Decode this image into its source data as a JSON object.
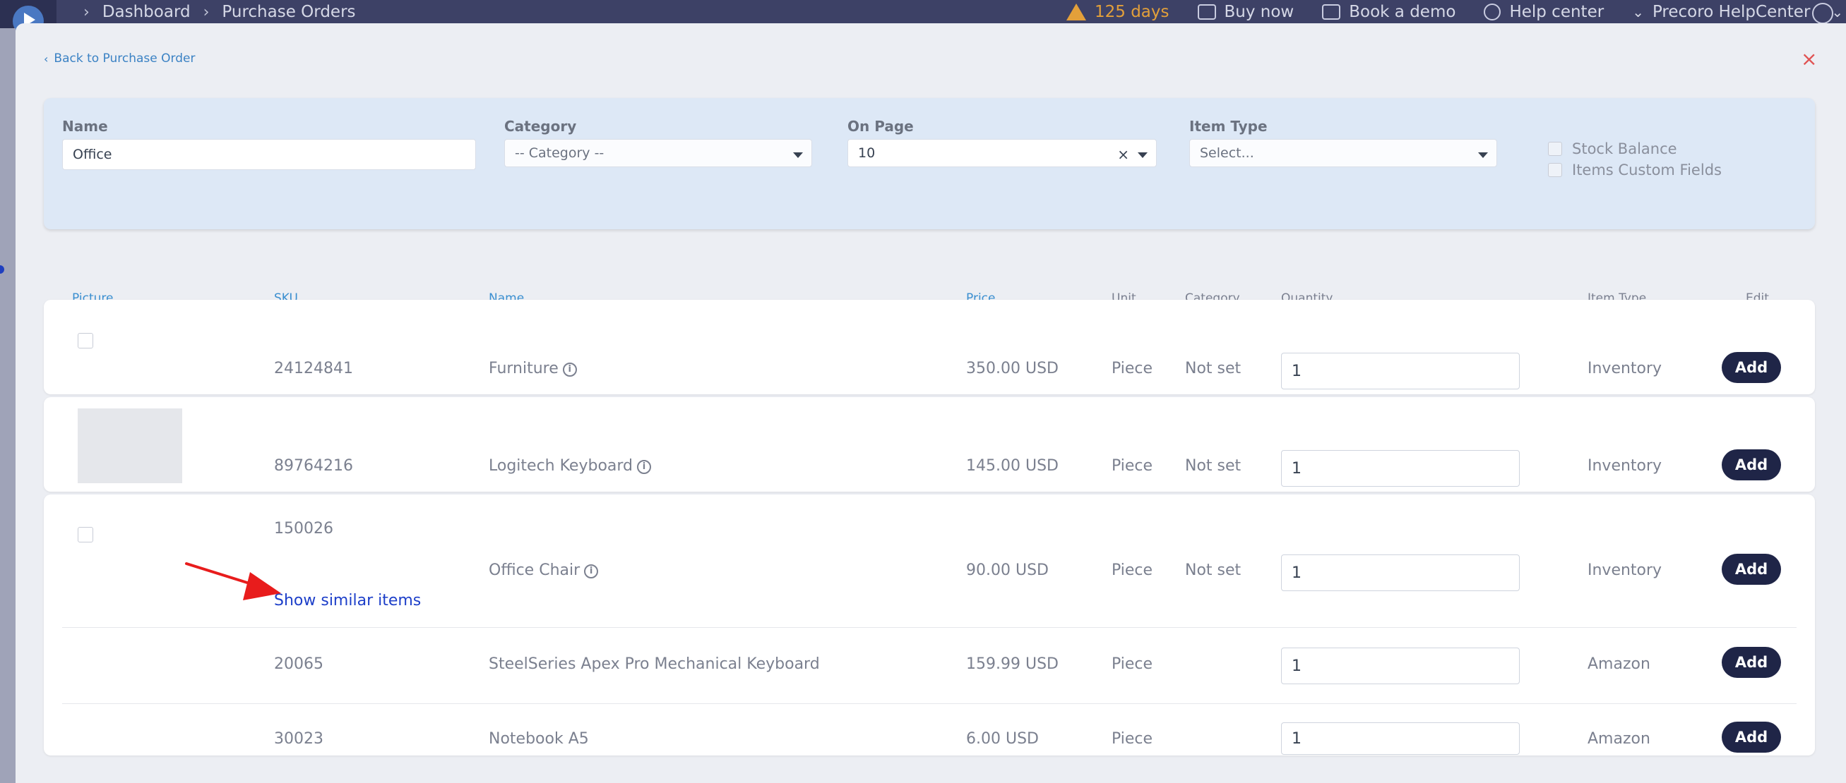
{
  "topbar": {
    "breadcrumbs": [
      "Dashboard",
      "Purchase Orders"
    ],
    "trial": "125 days",
    "buy_now": "Buy now",
    "book_demo": "Book a demo",
    "help_center": "Help center",
    "org": "Precoro HelpCenter"
  },
  "modal": {
    "back_label": "Back to Purchase Order",
    "close_symbol": "×"
  },
  "filters": {
    "name_label": "Name",
    "name_value": "Office",
    "category_label": "Category",
    "category_value": "-- Category --",
    "onpage_label": "On Page",
    "onpage_value": "10",
    "itemtype_label": "Item Type",
    "itemtype_placeholder": "Select...",
    "stock_balance": "Stock Balance",
    "custom_fields": "Items Custom Fields"
  },
  "table": {
    "headers": {
      "picture": "Picture",
      "sku": "SKU",
      "name": "Name",
      "price": "Price",
      "unit": "Unit",
      "category": "Category",
      "quantity": "Quantity",
      "item_type": "Item Type",
      "edit": "Edit"
    },
    "add_label": "Add",
    "show_similar": "Show similar items",
    "rows": [
      {
        "sku": "24124841",
        "name": "Furniture",
        "price": "350.00 USD",
        "unit": "Piece",
        "category": "Not set",
        "qty": "1",
        "type": "Inventory"
      },
      {
        "sku": "89764216",
        "name": "Logitech Keyboard",
        "price": "145.00 USD",
        "unit": "Piece",
        "category": "Not set",
        "qty": "1",
        "type": "Inventory"
      },
      {
        "sku": "150026",
        "name": "Office Chair",
        "price": "90.00 USD",
        "unit": "Piece",
        "category": "Not set",
        "qty": "1",
        "type": "Inventory"
      },
      {
        "sku": "20065",
        "name": "SteelSeries Apex Pro Mechanical Keyboard",
        "price": "159.99 USD",
        "unit": "Piece",
        "category": "",
        "qty": "1",
        "type": "Amazon"
      },
      {
        "sku": "30023",
        "name": "Notebook A5",
        "price": "6.00 USD",
        "unit": "Piece",
        "category": "",
        "qty": "1",
        "type": "Amazon"
      }
    ]
  },
  "colors": {
    "accent": "#3b8fd0",
    "button": "#1f2547",
    "link": "#1d3fc9",
    "annotation_arrow": "#e81c1c"
  }
}
